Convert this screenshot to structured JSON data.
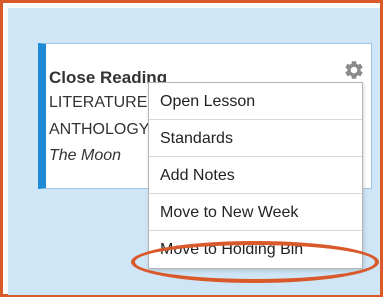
{
  "card": {
    "title": "Close Reading",
    "line1": "LITERATURE",
    "line2": "ANTHOLOGY",
    "line3": "The Moon",
    "accent_color": "#1e8ad6"
  },
  "icons": {
    "settings": "gear-icon"
  },
  "menu": {
    "items": [
      {
        "label": "Open Lesson"
      },
      {
        "label": "Standards"
      },
      {
        "label": "Add Notes"
      },
      {
        "label": "Move to New Week"
      },
      {
        "label": "Move to Holding Bin"
      }
    ],
    "highlighted_item": "Move to Holding Bin"
  },
  "colors": {
    "frame_border": "#d9592b",
    "panel_background": "#cfe6f6",
    "highlight_ring": "#d9592b"
  }
}
